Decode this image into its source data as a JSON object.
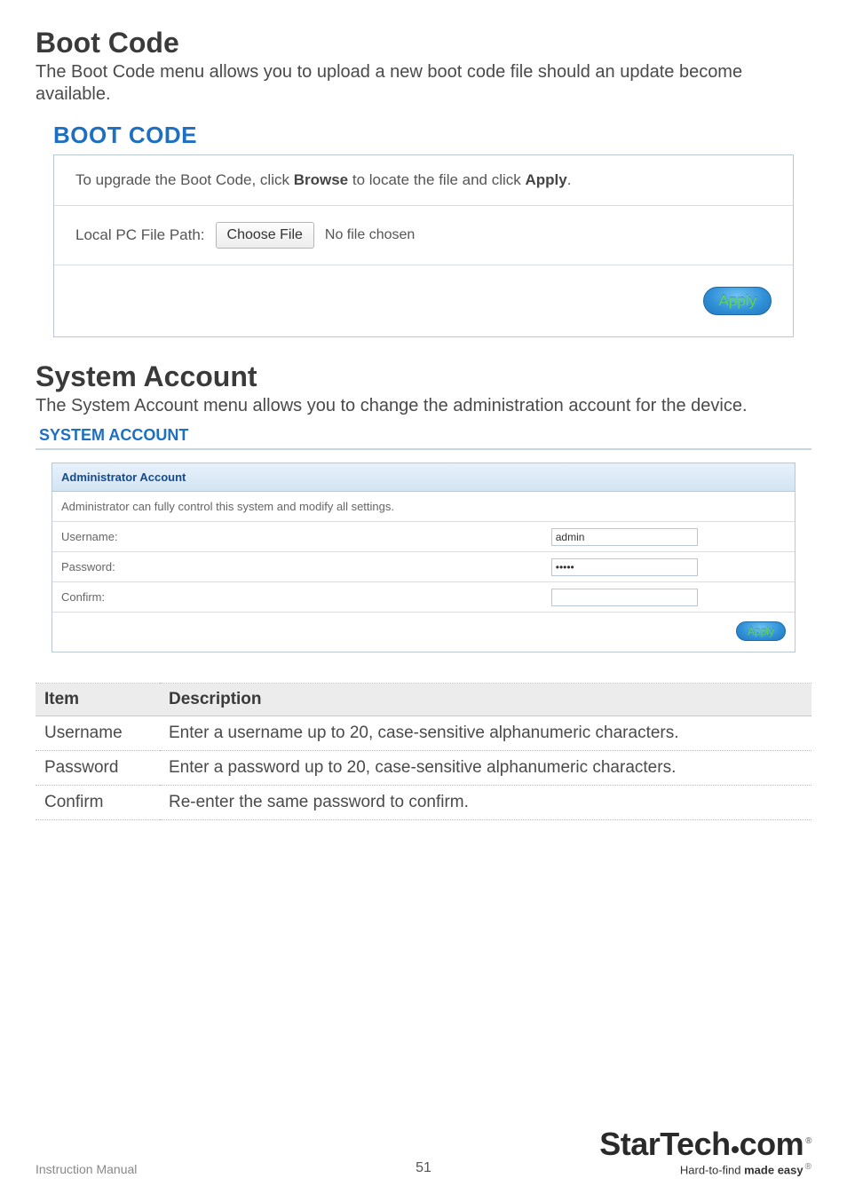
{
  "boot": {
    "heading": "Boot Code",
    "desc": "The Boot Code menu allows you to upload a new boot code file should an update become available.",
    "panel_title": "BOOT CODE",
    "instruction_pre": "To upgrade the Boot Code, click ",
    "instruction_b1": "Browse",
    "instruction_mid": " to locate the file and click ",
    "instruction_b2": "Apply",
    "instruction_post": ".",
    "path_label": "Local PC File Path:",
    "choose_file": "Choose File",
    "no_file": "No file chosen",
    "apply": "Apply"
  },
  "sys": {
    "heading": "System Account",
    "desc": "The System Account menu allows you to change the administration account for the device.",
    "panel_title": "SYSTEM ACCOUNT",
    "subheader": "Administrator Account",
    "note": "Administrator can fully control this system and modify all settings.",
    "username_label": "Username:",
    "username_value": "admin",
    "password_label": "Password:",
    "password_value": "•••••",
    "confirm_label": "Confirm:",
    "confirm_value": "",
    "apply": "Apply"
  },
  "table": {
    "col_item": "Item",
    "col_desc": "Description",
    "rows": [
      {
        "item": "Username",
        "desc": "Enter a username up to 20, case-sensitive alphanumeric characters."
      },
      {
        "item": "Password",
        "desc": "Enter a password up to 20, case-sensitive alphanumeric characters."
      },
      {
        "item": "Confirm",
        "desc": "Re-enter the same password to confirm."
      }
    ]
  },
  "footer": {
    "manual": "Instruction Manual",
    "page": "51",
    "logo_a": "StarTech",
    "logo_b": "com",
    "reg": "®",
    "tagline_a": "Hard-to-find ",
    "tagline_b": "made easy",
    "tagline_reg": "®"
  }
}
